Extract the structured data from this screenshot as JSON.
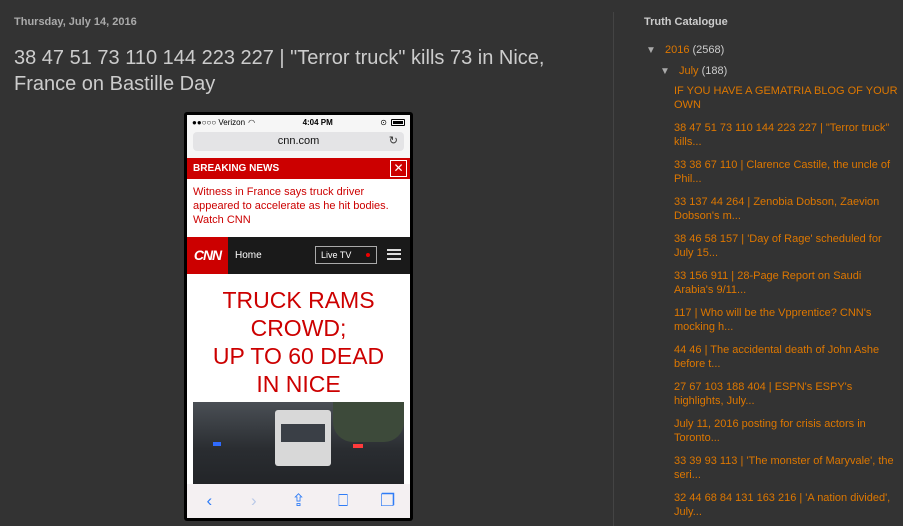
{
  "post": {
    "date": "Thursday, July 14, 2016",
    "title": "38 47 51 73 110 144 223 227 | \"Terror truck\" kills 73 in Nice, France on Bastille Day"
  },
  "phone": {
    "carrier": "●●○○○ Verizon",
    "time": "4:04 PM",
    "url": "cnn.com",
    "breaking_label": "BREAKING NEWS",
    "breaking_close": "✕",
    "breaking_text": "Witness in France says truck driver appeared to accelerate as he hit bodies. Watch CNN",
    "logo": "CNN",
    "nav_home": "Home",
    "live_tv": "Live TV",
    "headline_lines": [
      "TRUCK RAMS",
      "CROWD;",
      "UP TO 60 DEAD",
      "IN NICE"
    ],
    "toolbar_icons": [
      "back-icon",
      "forward-icon",
      "share-icon",
      "bookmarks-icon",
      "tabs-icon"
    ]
  },
  "sidebar": {
    "title": "Truth Catalogue",
    "year": {
      "label": "2016",
      "count": "(2568)",
      "toggle": "▼"
    },
    "month": {
      "label": "July",
      "count": "(188)",
      "toggle": "▼"
    },
    "posts": [
      "IF YOU HAVE A GEMATRIA BLOG OF YOUR OWN",
      "38 47 51 73 110 144 223 227 | \"Terror truck\" kills...",
      "33 38 67 110 | Clarence Castile, the uncle of Phil...",
      "33 137 44 264 | Zenobia Dobson, Zaevion Dobson's m...",
      "38 46 58 157 | 'Day of Rage' scheduled for July 15...",
      "33 156 911 | 28-Page Report on Saudi Arabia's 9/11...",
      "117 | Who will be the Vpprentice? CNN's mocking h...",
      "44 46 | The accidental death of John Ashe before t...",
      "27 67 103 188 404 | ESPN's ESPY's highlights, July...",
      "July 11, 2016 posting for crisis actors in Toronto...",
      "33 39 93 113 | 'The monster of Maryvale', the seri...",
      "32 44 68 84 131 163 216 | 'A nation divided', July..."
    ]
  },
  "colors": {
    "background": "#333333",
    "link": "#dd7700",
    "cnn_red": "#cc0000"
  }
}
